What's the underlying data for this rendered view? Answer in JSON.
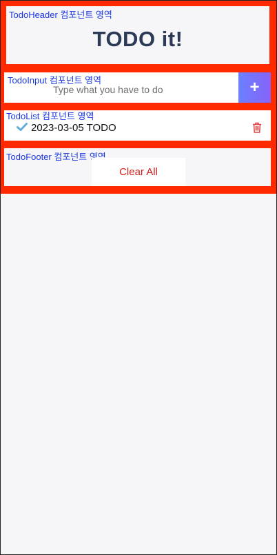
{
  "header": {
    "label": "TodoHeader 컴포넌트 영역",
    "title": "TODO it!"
  },
  "input": {
    "label": "TodoInput 컴포넌트 영역",
    "placeholder": "Type what you have to do",
    "add_icon": "plus-icon",
    "add_symbol": "+"
  },
  "list": {
    "label": "TodoList 컴포넌트 영역",
    "items": [
      {
        "text": "2023-03-05 TODO",
        "check_icon": "checkmark-icon",
        "delete_icon": "trash-icon"
      }
    ]
  },
  "footer": {
    "label": "TodoFooter 컴포넌트 영역",
    "clear_label": "Clear All"
  },
  "colors": {
    "frame_red": "#ff2a00",
    "label_blue": "#1a38e0",
    "title": "#2c3a55",
    "add_gradient_start": "#6b80ff",
    "add_gradient_end": "#8763f7",
    "check": "#62acde",
    "trash": "#de4343",
    "clear_text": "#cf1d1d"
  }
}
